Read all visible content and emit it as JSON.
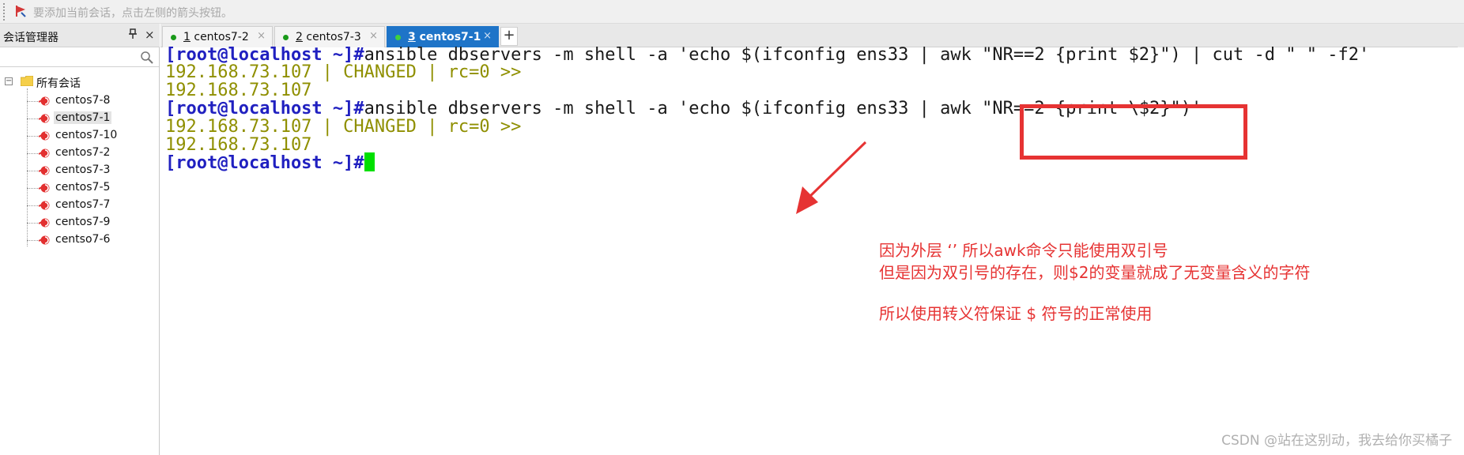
{
  "topbar": {
    "hint": "要添加当前会话，点击左侧的箭头按钮。"
  },
  "sidebar": {
    "title": "会话管理器",
    "pin_glyph": "𝖯",
    "close_glyph": "×",
    "root_label": "所有会话",
    "items": [
      {
        "label": "centos7-8",
        "selected": false
      },
      {
        "label": "centos7-1",
        "selected": true
      },
      {
        "label": "centos7-10",
        "selected": false
      },
      {
        "label": "centos7-2",
        "selected": false
      },
      {
        "label": "centos7-3",
        "selected": false
      },
      {
        "label": "centos7-5",
        "selected": false
      },
      {
        "label": "centos7-7",
        "selected": false
      },
      {
        "label": "centos7-9",
        "selected": false
      },
      {
        "label": "centso7-6",
        "selected": false
      }
    ]
  },
  "tabs": [
    {
      "num": "1",
      "label": " centos7-2",
      "close": "×",
      "active": false
    },
    {
      "num": "2",
      "label": " centos7-3",
      "close": "×",
      "active": false
    },
    {
      "num": "3",
      "label": " centos7-1",
      "close": "×",
      "active": true
    }
  ],
  "tab_add": "+",
  "terminal": {
    "prompt": "[root@localhost ~]#",
    "line1_cmd": "ansible dbservers -m shell -a 'echo $(ifconfig ens33 | awk \"NR==2 {print $2}\") | cut -d \" \" -f2'",
    "line2": "192.168.73.107 | CHANGED | rc=0 >>",
    "line3": "192.168.73.107",
    "line4_cmd": "ansible dbservers -m shell -a 'echo $(ifconfig ens33 | awk \"NR==2 {print \\$2}\")'",
    "line5": "192.168.73.107 | CHANGED | rc=0 >>",
    "line6": "192.168.73.107"
  },
  "annotation": {
    "line1": "因为外层  ‘’  所以awk命令只能使用双引号",
    "line2": "但是因为双引号的存在，则$2的变量就成了无变量含义的字符",
    "line3": "所以使用转义符保证 $ 符号的正常使用",
    "color": "#e63333"
  },
  "watermark": "CSDN @站在这别动，我去给你买橘子",
  "colors": {
    "prompt": "#2020c0",
    "output": "#8f8f00",
    "cursor": "#00e000",
    "tab_active": "#1e74c8"
  }
}
